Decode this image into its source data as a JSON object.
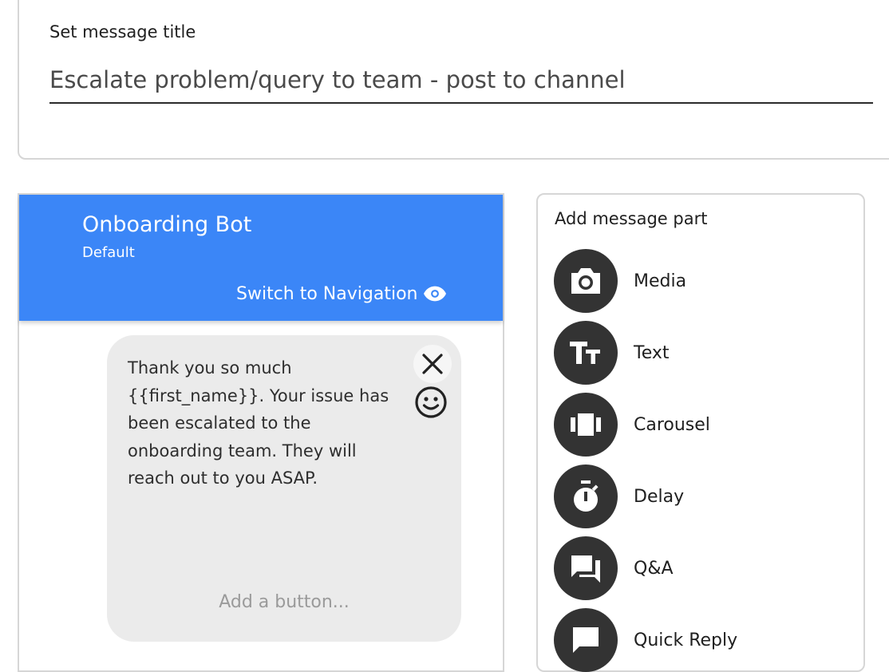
{
  "title_section": {
    "label": "Set message title",
    "value": "Escalate problem/query to team - post to channel"
  },
  "preview": {
    "bot_name": "Onboarding Bot",
    "bot_profile": "Default",
    "switch_label": "Switch to Navigation",
    "message_text": "Thank you so much {{first_name}}. Your issue has been escalated to the onboarding team. They will reach out to you ASAP.",
    "add_button_label": "Add a button...",
    "header_color": "#3b86f7"
  },
  "message_parts": {
    "title": "Add message part",
    "items": [
      {
        "label": "Media",
        "icon": "camera-icon"
      },
      {
        "label": "Text",
        "icon": "text-fields-icon"
      },
      {
        "label": "Carousel",
        "icon": "carousel-icon"
      },
      {
        "label": "Delay",
        "icon": "timer-icon"
      },
      {
        "label": "Q&A",
        "icon": "forum-icon"
      },
      {
        "label": "Quick Reply",
        "icon": "chat-bubble-icon"
      }
    ]
  }
}
